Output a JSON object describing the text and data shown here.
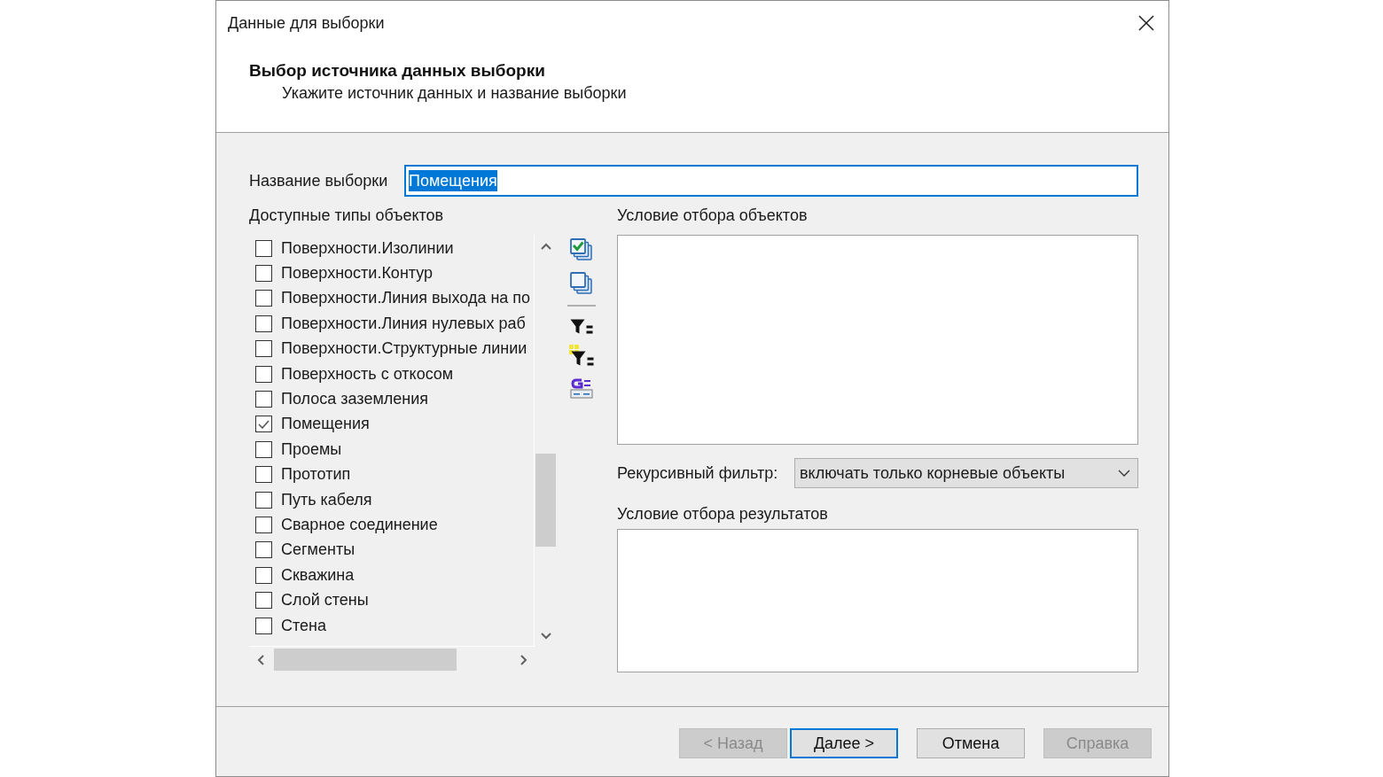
{
  "dialog": {
    "title": "Данные для выборки"
  },
  "header": {
    "heading": "Выбор источника данных выборки",
    "subheading": "Укажите источник данных и название выборки"
  },
  "name_field": {
    "label": "Название выборки",
    "value": "Помещения",
    "focused": true
  },
  "object_types": {
    "label": "Доступные типы объектов",
    "items": [
      {
        "label": "Поверхности.Изолинии",
        "checked": false
      },
      {
        "label": "Поверхности.Контур",
        "checked": false
      },
      {
        "label": "Поверхности.Линия выхода на по",
        "checked": false
      },
      {
        "label": "Поверхности.Линия нулевых раб",
        "checked": false
      },
      {
        "label": "Поверхности.Структурные линии",
        "checked": false
      },
      {
        "label": "Поверхность с откосом",
        "checked": false
      },
      {
        "label": "Полоса заземления",
        "checked": false
      },
      {
        "label": "Помещения",
        "checked": true
      },
      {
        "label": "Проемы",
        "checked": false
      },
      {
        "label": "Прототип",
        "checked": false
      },
      {
        "label": "Путь кабеля",
        "checked": false
      },
      {
        "label": "Сварное соединение",
        "checked": false
      },
      {
        "label": "Сегменты",
        "checked": false
      },
      {
        "label": "Скважина",
        "checked": false
      },
      {
        "label": "Слой стены",
        "checked": false
      },
      {
        "label": "Стена",
        "checked": false
      }
    ]
  },
  "object_condition": {
    "label": "Условие отбора объектов"
  },
  "recursive_filter": {
    "label": "Рекурсивный фильтр:",
    "value": "включать только корневые объекты"
  },
  "result_condition": {
    "label": "Условие отбора результатов"
  },
  "buttons": [
    {
      "label": "< Назад",
      "disabled": true,
      "default": false
    },
    {
      "label": "Далее >",
      "disabled": false,
      "default": true
    },
    {
      "label": "Отмена",
      "disabled": false,
      "default": false
    },
    {
      "label": "Справка",
      "disabled": true,
      "default": false
    }
  ]
}
